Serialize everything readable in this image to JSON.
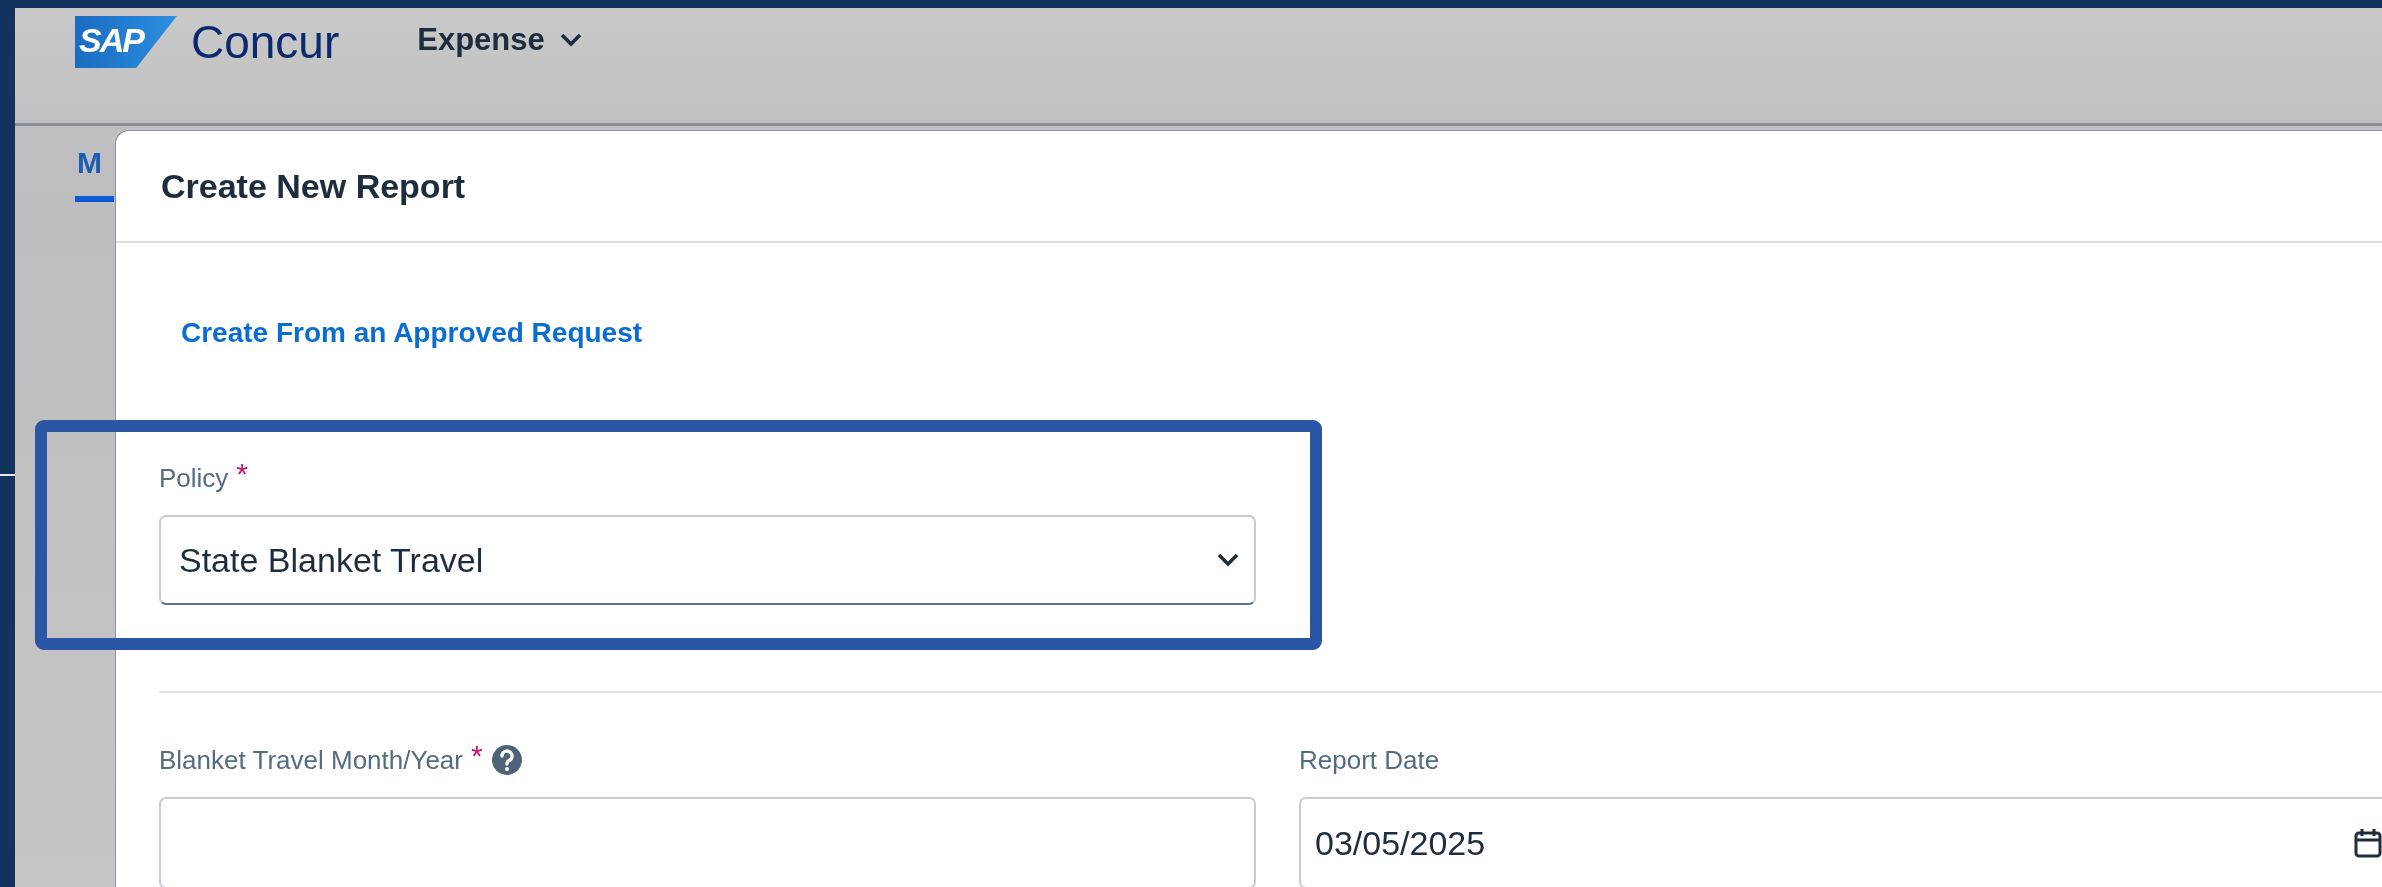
{
  "header": {
    "logo_mark": "SAP",
    "logo_text": "Concur",
    "product_menu": "Expense"
  },
  "tabs": [
    {
      "label": "M",
      "selected": true
    }
  ],
  "dialog": {
    "title": "Create New Report",
    "link": "Create From an Approved Request",
    "policy": {
      "label": "Policy",
      "required_mark": "*",
      "value": "State Blanket Travel",
      "highlighted": true
    },
    "fields": [
      {
        "label": "Blanket Travel Month/Year",
        "required_mark": "*",
        "help": true,
        "kind": "text"
      },
      {
        "label": "Report Date",
        "help": false,
        "kind": "date",
        "value": "03/05/2025"
      }
    ]
  }
}
